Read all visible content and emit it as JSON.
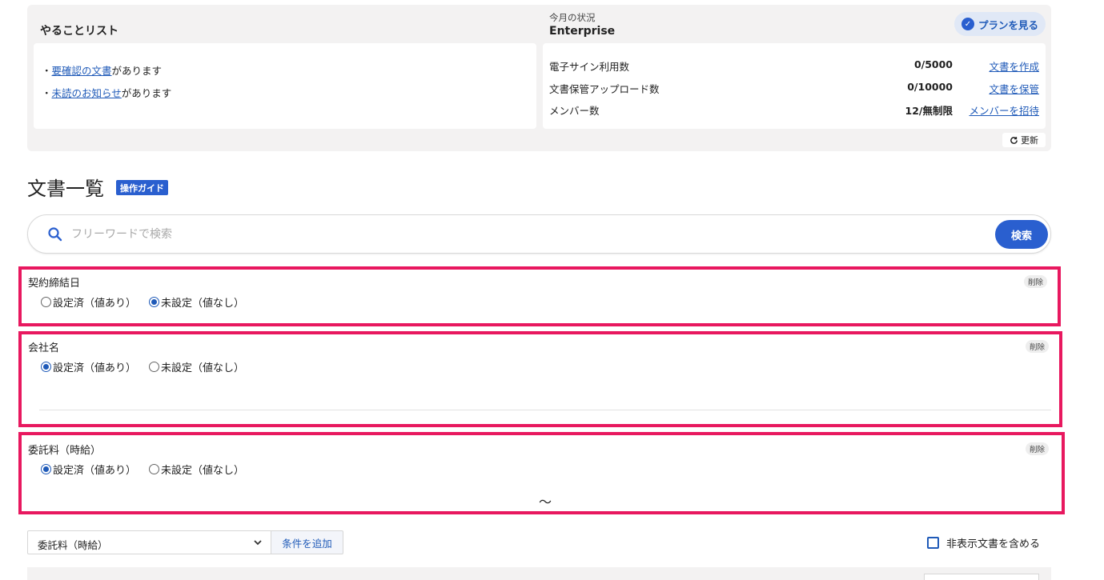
{
  "todo": {
    "title": "やることリスト",
    "items": [
      {
        "bullet": "・",
        "link": "要確認の文書",
        "rest": "があります"
      },
      {
        "bullet": "・",
        "link": "未読のお知らせ",
        "rest": "があります"
      }
    ]
  },
  "month_status": {
    "label": "今月の状況",
    "plan": "Enterprise",
    "plan_button": "プランを見る",
    "rows": [
      {
        "label": "電子サイン利用数",
        "value": "0/5000",
        "action": "文書を作成"
      },
      {
        "label": "文書保管アップロード数",
        "value": "0/10000",
        "action": "文書を保管"
      },
      {
        "label": "メンバー数",
        "value": "12/無制限",
        "action": "メンバーを招待"
      }
    ],
    "refresh_label": "更新"
  },
  "documents": {
    "title": "文書一覧",
    "guide_badge": "操作ガイド"
  },
  "search": {
    "placeholder": "フリーワードで検索",
    "value": "",
    "button": "検索"
  },
  "filters": [
    {
      "label": "契約締結日",
      "delete": "削除",
      "options": [
        "設定済（値あり）",
        "未設定（値なし）"
      ],
      "selected": 1
    },
    {
      "label": "会社名",
      "delete": "削除",
      "options": [
        "設定済（値あり）",
        "未設定（値なし）"
      ],
      "selected": 0
    },
    {
      "label": "委託料（時給）",
      "delete": "削除",
      "options": [
        "設定済（値あり）",
        "未設定（値なし）"
      ],
      "selected": 0,
      "range_separator": "～"
    }
  ],
  "add_condition": {
    "selected": "委託料（時給）",
    "button": "条件を追加"
  },
  "include_hidden": {
    "label": "非表示文書を含める",
    "checked": false
  },
  "colors": {
    "accent": "#2a5fcf",
    "link": "#1f5ab8",
    "highlight_border": "#e8185f"
  },
  "icons": {
    "search": "search-icon",
    "plan_badge": "verified-badge-icon",
    "refresh": "refresh-icon",
    "chevron": "chevron-down-icon"
  }
}
